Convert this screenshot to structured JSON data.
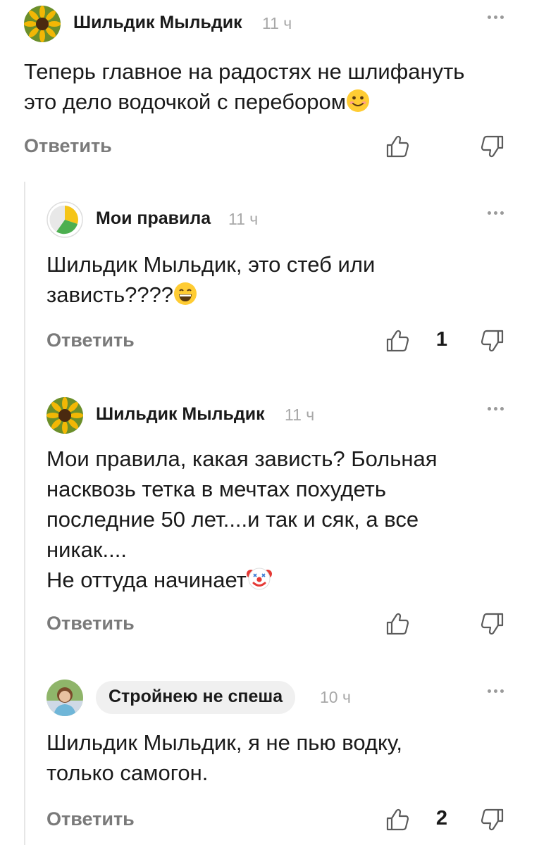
{
  "comments": [
    {
      "author": "Шильдик Мыльдик",
      "time": "11 ч",
      "lines": [
        "Теперь главное на радостях не шлифануть",
        "это дело водочкой с перебором"
      ],
      "emoji": "slightly-smiling-face",
      "reply_label": "Ответить",
      "likes": ""
    },
    {
      "author": "Мои правила",
      "time": "11 ч",
      "lines": [
        "Шильдик Мыльдик, это  стеб или",
        "зависть????"
      ],
      "emoji": "grinning-face",
      "reply_label": "Ответить",
      "likes": "1"
    },
    {
      "author": "Шильдик Мыльдик",
      "time": "11 ч",
      "lines": [
        "Мои правила,  какая зависть? Больная",
        "насквозь тетка в мечтах похудеть",
        "последние 50 лет....и так и сяк, а  все",
        "никак....",
        "Не оттуда начинает"
      ],
      "emoji": "clown-face",
      "reply_label": "Ответить",
      "likes": ""
    },
    {
      "author": "Стройнею не спеша",
      "time": "10 ч",
      "lines": [
        "Шильдик Мыльдик, я не пью водку,",
        "только самогон."
      ],
      "emoji": "",
      "reply_label": "Ответить",
      "likes": "2"
    }
  ],
  "colors": {
    "text": "#1a1a1a",
    "muted": "#a8a8a8",
    "action": "#7a7a7a",
    "thread_line": "#e6e6e6",
    "pill": "#f0f0f0"
  },
  "icons": [
    "sunflower-avatar-icon",
    "mybrand-logo-avatar-icon",
    "user-photo-avatar-icon",
    "more-dots-icon",
    "thumbs-up-icon",
    "thumbs-down-icon"
  ]
}
